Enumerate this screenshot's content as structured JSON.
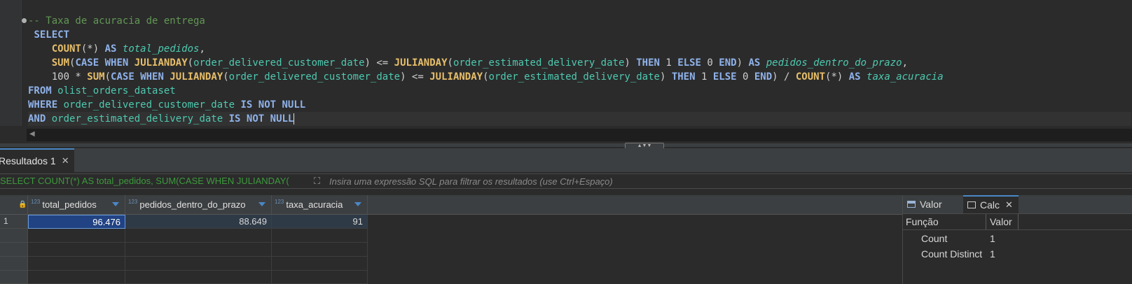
{
  "editor": {
    "lines": [
      [
        {
          "t": "-- Taxa de acuracia de entrega",
          "c": "cm"
        }
      ],
      [
        {
          "t": " ",
          "c": "tx"
        },
        {
          "t": "SELECT",
          "c": "kw"
        }
      ],
      [
        {
          "t": "    ",
          "c": "tx"
        },
        {
          "t": "COUNT",
          "c": "fn"
        },
        {
          "t": "(*) ",
          "c": "tx"
        },
        {
          "t": "AS",
          "c": "kw"
        },
        {
          "t": " ",
          "c": "tx"
        },
        {
          "t": "total_pedidos",
          "c": "al"
        },
        {
          "t": ",",
          "c": "tx"
        }
      ],
      [
        {
          "t": "    ",
          "c": "tx"
        },
        {
          "t": "SUM",
          "c": "fn"
        },
        {
          "t": "(",
          "c": "tx"
        },
        {
          "t": "CASE",
          "c": "kw"
        },
        {
          "t": " ",
          "c": "tx"
        },
        {
          "t": "WHEN",
          "c": "kw"
        },
        {
          "t": " ",
          "c": "tx"
        },
        {
          "t": "JULIANDAY",
          "c": "fn"
        },
        {
          "t": "(",
          "c": "tx"
        },
        {
          "t": "order_delivered_customer_date",
          "c": "col"
        },
        {
          "t": ") <= ",
          "c": "tx"
        },
        {
          "t": "JULIANDAY",
          "c": "fn"
        },
        {
          "t": "(",
          "c": "tx"
        },
        {
          "t": "order_estimated_delivery_date",
          "c": "col"
        },
        {
          "t": ") ",
          "c": "tx"
        },
        {
          "t": "THEN",
          "c": "kw"
        },
        {
          "t": " 1 ",
          "c": "tx"
        },
        {
          "t": "ELSE",
          "c": "kw"
        },
        {
          "t": " 0 ",
          "c": "tx"
        },
        {
          "t": "END",
          "c": "kw"
        },
        {
          "t": ") ",
          "c": "tx"
        },
        {
          "t": "AS",
          "c": "kw"
        },
        {
          "t": " ",
          "c": "tx"
        },
        {
          "t": "pedidos_dentro_do_prazo",
          "c": "al"
        },
        {
          "t": ",",
          "c": "tx"
        }
      ],
      [
        {
          "t": "    100 * ",
          "c": "tx"
        },
        {
          "t": "SUM",
          "c": "fn"
        },
        {
          "t": "(",
          "c": "tx"
        },
        {
          "t": "CASE",
          "c": "kw"
        },
        {
          "t": " ",
          "c": "tx"
        },
        {
          "t": "WHEN",
          "c": "kw"
        },
        {
          "t": " ",
          "c": "tx"
        },
        {
          "t": "JULIANDAY",
          "c": "fn"
        },
        {
          "t": "(",
          "c": "tx"
        },
        {
          "t": "order_delivered_customer_date",
          "c": "col"
        },
        {
          "t": ") <= ",
          "c": "tx"
        },
        {
          "t": "JULIANDAY",
          "c": "fn"
        },
        {
          "t": "(",
          "c": "tx"
        },
        {
          "t": "order_estimated_delivery_date",
          "c": "col"
        },
        {
          "t": ") ",
          "c": "tx"
        },
        {
          "t": "THEN",
          "c": "kw"
        },
        {
          "t": " 1 ",
          "c": "tx"
        },
        {
          "t": "ELSE",
          "c": "kw"
        },
        {
          "t": " 0 ",
          "c": "tx"
        },
        {
          "t": "END",
          "c": "kw"
        },
        {
          "t": ") / ",
          "c": "tx"
        },
        {
          "t": "COUNT",
          "c": "fn"
        },
        {
          "t": "(*) ",
          "c": "tx"
        },
        {
          "t": "AS",
          "c": "kw"
        },
        {
          "t": " ",
          "c": "tx"
        },
        {
          "t": "taxa_acuracia",
          "c": "al"
        }
      ],
      [
        {
          "t": "FROM",
          "c": "kw"
        },
        {
          "t": " ",
          "c": "tx"
        },
        {
          "t": "olist_orders_dataset",
          "c": "col"
        }
      ],
      [
        {
          "t": "WHERE",
          "c": "kw"
        },
        {
          "t": " ",
          "c": "tx"
        },
        {
          "t": "order_delivered_customer_date",
          "c": "col"
        },
        {
          "t": " ",
          "c": "tx"
        },
        {
          "t": "IS",
          "c": "kw"
        },
        {
          "t": " ",
          "c": "tx"
        },
        {
          "t": "NOT",
          "c": "kw"
        },
        {
          "t": " ",
          "c": "tx"
        },
        {
          "t": "NULL",
          "c": "kw"
        }
      ],
      [
        {
          "t": "AND",
          "c": "kw"
        },
        {
          "t": " ",
          "c": "tx"
        },
        {
          "t": "order_estimated_delivery_date",
          "c": "col"
        },
        {
          "t": " ",
          "c": "tx"
        },
        {
          "t": "IS",
          "c": "kw"
        },
        {
          "t": " ",
          "c": "tx"
        },
        {
          "t": "NOT",
          "c": "kw"
        },
        {
          "t": " ",
          "c": "tx"
        },
        {
          "t": "NULL",
          "c": "kw"
        }
      ]
    ]
  },
  "results": {
    "tab_label": "Resultados 1",
    "close_glyph": "✕",
    "filter_query": "SELECT COUNT(*) AS total_pedidos, SUM(CASE WHEN JULIANDAY(",
    "filter_placeholder": "Insira uma expressão SQL para filtrar os resultados (use Ctrl+Espaço)",
    "columns": [
      {
        "type": "123",
        "name": "total_pedidos"
      },
      {
        "type": "123",
        "name": "pedidos_dentro_do_prazo"
      },
      {
        "type": "123",
        "name": "taxa_acuracia"
      }
    ],
    "rows": [
      {
        "num": "1",
        "values": [
          "96.476",
          "88.649",
          "91"
        ]
      }
    ]
  },
  "panel": {
    "tabs": {
      "valor": "Valor",
      "calc": "Calc"
    },
    "headers": {
      "funcao": "Função",
      "valor": "Valor"
    },
    "rows": [
      {
        "fn": "Count",
        "val": "1"
      },
      {
        "fn": "Count Distinct",
        "val": "1"
      }
    ]
  },
  "colors": {
    "accent": "#4a88c7",
    "selection": "#214283"
  }
}
